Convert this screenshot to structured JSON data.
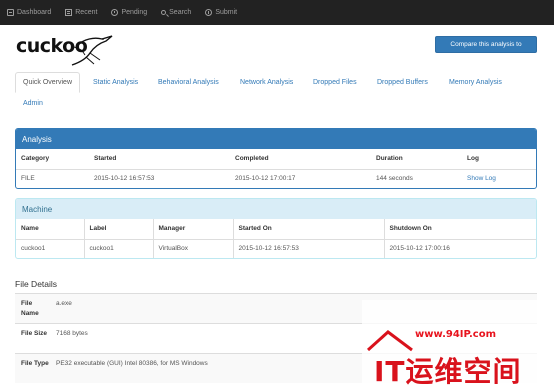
{
  "nav": {
    "items": [
      {
        "label": "Dashboard",
        "icon": "dashboard-icon"
      },
      {
        "label": "Recent",
        "icon": "list-icon"
      },
      {
        "label": "Pending",
        "icon": "clock-icon"
      },
      {
        "label": "Search",
        "icon": "search-icon"
      },
      {
        "label": "Submit",
        "icon": "upload-icon"
      }
    ]
  },
  "logo": {
    "text": "cuckoo"
  },
  "compare_button": "Compare this analysis to",
  "tabs": [
    {
      "label": "Quick Overview"
    },
    {
      "label": "Static Analysis"
    },
    {
      "label": "Behavioral Analysis"
    },
    {
      "label": "Network Analysis"
    },
    {
      "label": "Dropped Files"
    },
    {
      "label": "Dropped Buffers"
    },
    {
      "label": "Memory Analysis"
    },
    {
      "label": "Admin"
    }
  ],
  "analysis": {
    "title": "Analysis",
    "headers": [
      "Category",
      "Started",
      "Completed",
      "Duration",
      "Log"
    ],
    "row": {
      "category": "FILE",
      "started": "2015-10-12 16:57:53",
      "completed": "2015-10-12 17:00:17",
      "duration": "144 seconds",
      "log": "Show Log"
    }
  },
  "machine": {
    "title": "Machine",
    "headers": [
      "Name",
      "Label",
      "Manager",
      "Started On",
      "Shutdown On"
    ],
    "row": {
      "name": "cuckoo1",
      "label": "cuckoo1",
      "manager": "VirtualBox",
      "started_on": "2015-10-12 16:57:53",
      "shutdown_on": "2015-10-12 17:00:16"
    }
  },
  "file_details": {
    "title": "File Details",
    "rows": [
      {
        "key": "File Name",
        "value": "a.exe"
      },
      {
        "key": "File Size",
        "value": "7168 bytes"
      },
      {
        "key": "File Type",
        "value": "PE32 executable (GUI) Intel 80386, for MS Windows"
      }
    ]
  },
  "watermark": {
    "url": "www.94IP.com",
    "text": "IT运维空间"
  },
  "colors": {
    "navbar": "#222222",
    "primary": "#337ab7",
    "info_bg": "#d9edf7",
    "watermark": "#d9121c"
  }
}
